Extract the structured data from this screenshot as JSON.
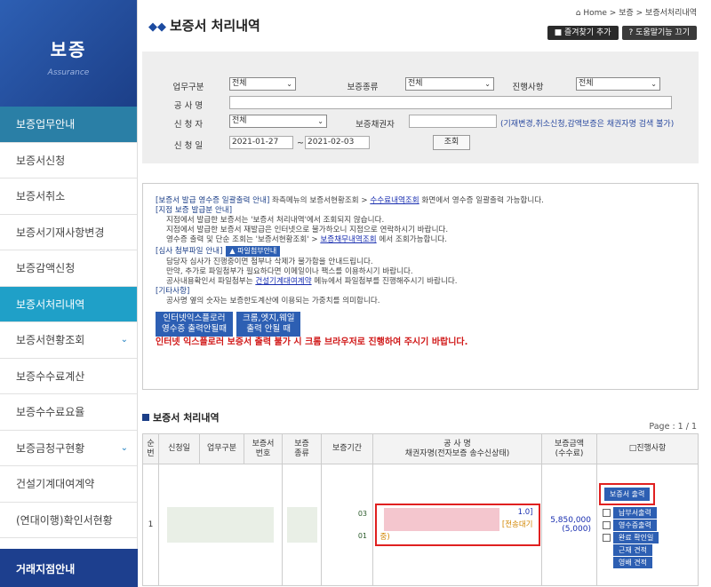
{
  "sidebar": {
    "title": "보증",
    "subtitle": "Assurance",
    "items": [
      {
        "label": "보증업무안내",
        "style": "hl"
      },
      {
        "label": "보증서신청",
        "style": ""
      },
      {
        "label": "보증서취소",
        "style": ""
      },
      {
        "label": "보증서기재사항변경",
        "style": ""
      },
      {
        "label": "보증감액신청",
        "style": ""
      },
      {
        "label": "보증서처리내역",
        "style": "active"
      },
      {
        "label": "보증서현황조회",
        "style": "chev"
      },
      {
        "label": "보증수수료계산",
        "style": ""
      },
      {
        "label": "보증수수료요율",
        "style": ""
      },
      {
        "label": "보증금청구현황",
        "style": "chev"
      },
      {
        "label": "건설기계대여계약",
        "style": ""
      },
      {
        "label": "(연대이행)확인서현황",
        "style": ""
      }
    ],
    "footer": "거래지점안내"
  },
  "header": {
    "breadcrumb": "⌂ Home > 보증 > 보증서처리내역",
    "title": "보증서 처리내역",
    "bookmark_btn": "즐겨찾기 추가",
    "help_btn": "도움말기능 끄기"
  },
  "search": {
    "work_label": "업무구분",
    "work_value": "전체",
    "type_label": "보증종류",
    "type_value": "전체",
    "progress_label": "진행사항",
    "progress_value": "전체",
    "project_label": "공 사 명",
    "project_value": "",
    "applicant_label": "신 청 자",
    "applicant_value": "전체",
    "creditor_label": "보증채권자",
    "creditor_value": "",
    "creditor_note": "(기재변경,취소신청,감액보증은 채권자명 검색 불가)",
    "date_label": "신 청 일",
    "date_from": "2021-01-27",
    "date_sep": "~",
    "date_to": "2021-02-03",
    "search_btn": "조회"
  },
  "info": {
    "l1a": "[보증서 발급 영수증 일괄출력 안내]",
    "l1b": " 좌측메뉴의 보증서현황조회 > ",
    "l1c": "수수료내역조회",
    "l1d": " 화면에서 영수증 일괄출력 가능합니다.",
    "l2": "[지점 보증 발급분 안내]",
    "l3": "지점에서 발급한 보증서는 '보증서 처리내역'에서 조회되지 않습니다.",
    "l4": "지점에서 발급한 보증서 재발급은 인터넷으로 불가하오니 지점으로 연락하시기 바랍니다.",
    "l5a": "영수증 출력 및 단순 조회는 '보증서현황조회' > ",
    "l5b": "보증채무내역조회",
    "l5c": " 에서 조회가능합니다.",
    "l6": "[심사 첨부파일 안내]",
    "attach_btn": "▲ 파일첨부안내",
    "l7": "담당자 심사가 진행중이면 첨부나 삭제가 불가함을 안내드립니다.",
    "l8": "만약, 추가로 파일첨부가 필요하다면 이메일이나 팩스를 이용하시기 바랍니다.",
    "l9a": "공사내용확인서 파일첨부는 ",
    "l9b": "건설기계대여계약",
    "l9c": " 메뉴에서 파일첨부를 진행해주시기 바랍니다.",
    "l10": "[기타사항]",
    "l11": "공사명 옆의 숫자는 보증한도계산에 이용되는 가중치를 의미합니다.",
    "ie_btn_1": "인터넷익스플로러",
    "ie_btn_2": "영수증 출력안될때",
    "chrome_btn_1": "크롬,엣지,웨일",
    "chrome_btn_2": "출력 안될 때",
    "warning": "인터넷 익스플로러 보증서 출력 불가 시 크롬 브라우저로 진행하여 주시기 바랍니다."
  },
  "list": {
    "section_title": "보증서 처리내역",
    "page": "Page : 1 / 1",
    "headers": {
      "no": [
        "순",
        "번"
      ],
      "date": "신청일",
      "work": "업무구분",
      "cert": [
        "보증서",
        "번호"
      ],
      "kind": [
        "보증",
        "종류"
      ],
      "period": "보증기간",
      "name": [
        "공 사 명",
        "채권자명(전자보증 송수신상태)"
      ],
      "amount": [
        "보증금액",
        "(수수료)"
      ],
      "status": "□진행사항"
    },
    "row": {
      "no": "1",
      "period_frag_1": "03",
      "period_frag_2": "01",
      "name_frag_1": "1.0]",
      "name_frag_2": "[전송대기",
      "name_frag_3": "중)",
      "amount": "5,850,000",
      "fee": "(5,000)",
      "actions": [
        "보증서 출력",
        "납부서출력",
        "영수증출력",
        "완료 확인일",
        "근재 견적",
        "영배 견적"
      ]
    }
  }
}
